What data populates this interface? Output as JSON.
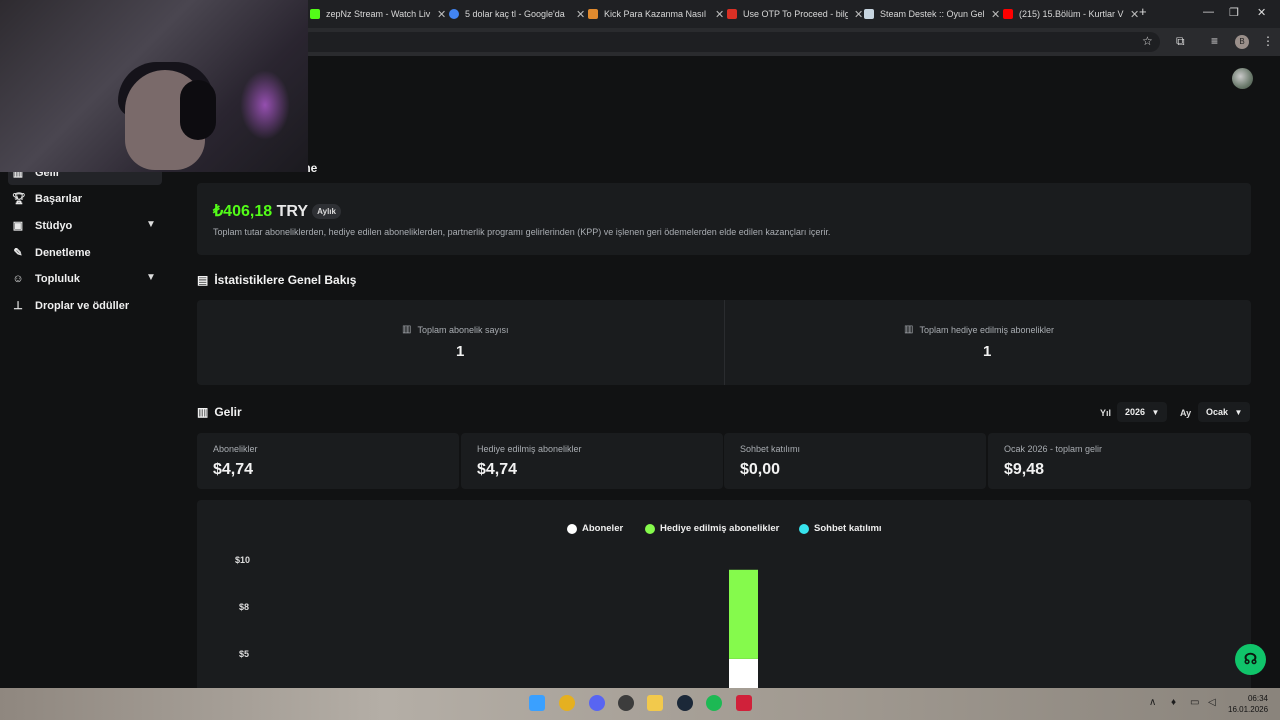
{
  "browser": {
    "tabs": [
      {
        "title": "zepNz Stream - Watch Liv",
        "color": "#53fc18"
      },
      {
        "title": "5 dolar kaç tl - Google'da",
        "color": "#4285f4"
      },
      {
        "title": "Kick Para Kazanma Nasıl",
        "color": "#e08a2e"
      },
      {
        "title": "Use OTP To Proceed - bilg",
        "color": "#d93025"
      },
      {
        "title": "Steam Destek :: Oyun Gel",
        "color": "#c7d5e0"
      },
      {
        "title": "(215) 15.Bölüm - Kurtlar V",
        "color": "#ff0000"
      }
    ],
    "new_tab": "+",
    "profile_initial": "B"
  },
  "sidebar": {
    "items": [
      {
        "label": "Gelir",
        "icon": "bar-chart-icon"
      },
      {
        "label": "Başarılar",
        "icon": "trophy-icon"
      },
      {
        "label": "Stüdyo",
        "icon": "studio-icon",
        "expandable": true
      },
      {
        "label": "Denetleme",
        "icon": "wrench-icon"
      },
      {
        "label": "Topluluk",
        "icon": "community-icon",
        "expandable": true
      },
      {
        "label": "Droplar ve ödüller",
        "icon": "drops-icon"
      }
    ]
  },
  "earnings": {
    "title_partial": "me",
    "amount": "₺406,18",
    "currency": "TRY",
    "badge": "Aylık",
    "description": "Toplam tutar aboneliklerden, hediye edilen aboneliklerden, partnerlik programı gelirlerinden (KPP) ve işlenen geri ödemelerden elde edilen kazançları içerir."
  },
  "overview": {
    "title": "İstatistiklere Genel Bakış",
    "stats": [
      {
        "label": "Toplam abonelik sayısı",
        "value": "1"
      },
      {
        "label": "Toplam hediye edilmiş abonelikler",
        "value": "1"
      }
    ]
  },
  "revenue": {
    "title": "Gelir",
    "year_label": "Yıl",
    "year_value": "2026",
    "month_label": "Ay",
    "month_value": "Ocak",
    "cards": [
      {
        "label": "Abonelikler",
        "value": "$4,74"
      },
      {
        "label": "Hediye edilmiş abonelikler",
        "value": "$4,74"
      },
      {
        "label": "Sohbet katılımı",
        "value": "$0,00"
      },
      {
        "label": "Ocak 2026 - toplam gelir",
        "value": "$9,48"
      }
    ]
  },
  "chart_data": {
    "type": "bar",
    "stacked": true,
    "legend_position": "top",
    "series": [
      {
        "name": "Aboneler",
        "color": "#ffffff",
        "values": [
          4.74
        ]
      },
      {
        "name": "Hediye edilmiş abonelikler",
        "color": "#85fa4c",
        "values": [
          4.74
        ]
      },
      {
        "name": "Sohbet katılımı",
        "color": "#37e3ed",
        "values": [
          0
        ]
      }
    ],
    "y_ticks": [
      "$10",
      "$8",
      "$5"
    ],
    "ylim": [
      0,
      10
    ]
  },
  "taskbar": {
    "time": "06:34",
    "date": "16.01.2026"
  }
}
